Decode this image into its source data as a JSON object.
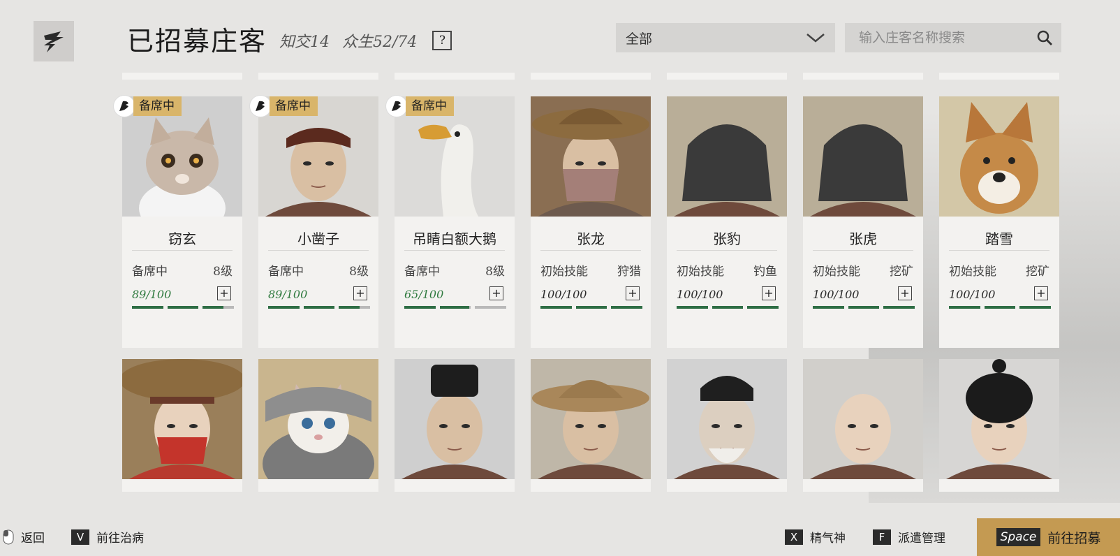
{
  "header": {
    "title": "已招募庄客",
    "friends_label": "知交14",
    "beings_label": "众生52/74",
    "help_label": "?"
  },
  "filter": {
    "selected": "全部"
  },
  "search": {
    "placeholder": "输入庄客名称搜索"
  },
  "colors": {
    "accent_gold": "#d9b56a",
    "bar_green": "#2e6e45",
    "recruit_bg": "#c49a52"
  },
  "cards_row1": [
    {
      "name": "窃玄",
      "stat_l": "备席中",
      "stat_r": "8级",
      "vitality": "89/100",
      "vit_fraction": 0.89,
      "badge": "备席中",
      "portrait": "cat"
    },
    {
      "name": "小凿子",
      "stat_l": "备席中",
      "stat_r": "8级",
      "vitality": "89/100",
      "vit_fraction": 0.89,
      "badge": "备席中",
      "portrait": "youth-headband"
    },
    {
      "name": "吊睛白额大鹅",
      "stat_l": "备席中",
      "stat_r": "8级",
      "vitality": "65/100",
      "vit_fraction": 0.65,
      "badge": "备席中",
      "portrait": "goose"
    },
    {
      "name": "张龙",
      "stat_l": "初始技能",
      "stat_r": "狩猎",
      "vitality": "100/100",
      "vit_fraction": 1.0,
      "badge": "",
      "portrait": "straw-hat-masked"
    },
    {
      "name": "张豹",
      "stat_l": "初始技能",
      "stat_r": "钓鱼",
      "vitality": "100/100",
      "vit_fraction": 1.0,
      "badge": "",
      "portrait": "warpaint-man"
    },
    {
      "name": "张虎",
      "stat_l": "初始技能",
      "stat_r": "挖矿",
      "vitality": "100/100",
      "vit_fraction": 1.0,
      "badge": "",
      "portrait": "warpaint-man"
    },
    {
      "name": "踏雪",
      "stat_l": "初始技能",
      "stat_r": "挖矿",
      "vitality": "100/100",
      "vit_fraction": 1.0,
      "badge": "",
      "portrait": "dog"
    }
  ],
  "cards_row2": [
    {
      "portrait": "child-red-mask"
    },
    {
      "portrait": "cat-scarf"
    },
    {
      "portrait": "scholar"
    },
    {
      "portrait": "straw-hat-man"
    },
    {
      "portrait": "old-man"
    },
    {
      "portrait": "monk"
    },
    {
      "portrait": "girl"
    }
  ],
  "footer": {
    "back_label": "返回",
    "heal_key": "V",
    "heal_label": "前往治病",
    "energy_key": "X",
    "energy_label": "精气神",
    "dispatch_key": "F",
    "dispatch_label": "派遣管理",
    "recruit_key": "Space",
    "recruit_label": "前往招募"
  }
}
